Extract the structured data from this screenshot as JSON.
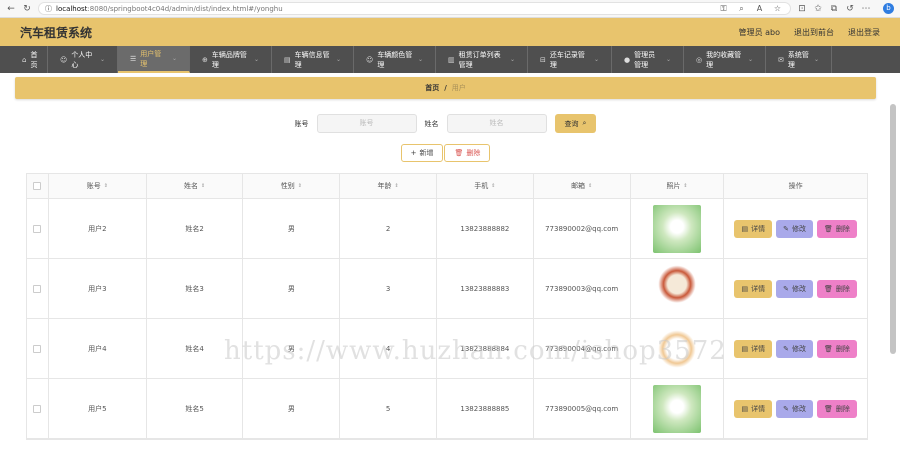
{
  "browser": {
    "url_host": "localhost",
    "url_rest": ":8080/springboot4c04d/admin/dist/index.html#/yonghu",
    "ext_label": "b"
  },
  "header": {
    "title": "汽车租赁系统",
    "user": "管理员 abo",
    "front": "退出到前台",
    "logout": "退出登录"
  },
  "menu": [
    {
      "icon": "⌂",
      "label": "首页",
      "arrow": ""
    },
    {
      "icon": "☺",
      "label": "个人中心",
      "arrow": "⌄"
    },
    {
      "icon": "☰",
      "label": "用户管理",
      "arrow": "⌄"
    },
    {
      "icon": "⊕",
      "label": "车辆品牌管理",
      "arrow": "⌄"
    },
    {
      "icon": "▤",
      "label": "车辆信息管理",
      "arrow": "⌄"
    },
    {
      "icon": "☺",
      "label": "车辆颜色管理",
      "arrow": "⌄"
    },
    {
      "icon": "▥",
      "label": "租赁订单列表管理",
      "arrow": "⌄"
    },
    {
      "icon": "⊟",
      "label": "还车记录管理",
      "arrow": "⌄"
    },
    {
      "icon": "●",
      "label": "管理员管理",
      "arrow": "⌄"
    },
    {
      "icon": "◎",
      "label": "我的收藏管理",
      "arrow": "⌄"
    },
    {
      "icon": "✉",
      "label": "系统管理",
      "arrow": "⌄"
    }
  ],
  "breadcrumb": {
    "home": "首页",
    "sep": "/",
    "current": "用户"
  },
  "search": {
    "account_label": "账号",
    "account_placeholder": "账号",
    "name_label": "姓名",
    "name_placeholder": "姓名",
    "query": "查询"
  },
  "actions": {
    "add": "新增",
    "delete": "删除"
  },
  "table": {
    "headers": [
      "账号",
      "姓名",
      "性别",
      "年龄",
      "手机",
      "邮箱",
      "照片",
      "操作"
    ],
    "rows": [
      {
        "account": "用户2",
        "name": "姓名2",
        "gender": "男",
        "age": "2",
        "phone": "13823888882",
        "email": "773890002@qq.com"
      },
      {
        "account": "用户3",
        "name": "姓名3",
        "gender": "男",
        "age": "3",
        "phone": "13823888883",
        "email": "773890003@qq.com"
      },
      {
        "account": "用户4",
        "name": "姓名4",
        "gender": "男",
        "age": "4",
        "phone": "13823888884",
        "email": "773890004@qq.com"
      },
      {
        "account": "用户5",
        "name": "姓名5",
        "gender": "男",
        "age": "5",
        "phone": "13823888885",
        "email": "773890005@qq.com"
      }
    ],
    "btn_detail": "详情",
    "btn_edit": "修改",
    "btn_delete": "删除"
  },
  "watermark": "https://www.huzhan.com/ishop3572",
  "colors": {
    "accent": "#e8c46d",
    "menu_bg": "#4f4f4f",
    "edit": "#a9a9ea",
    "delete": "#ee80c8"
  }
}
